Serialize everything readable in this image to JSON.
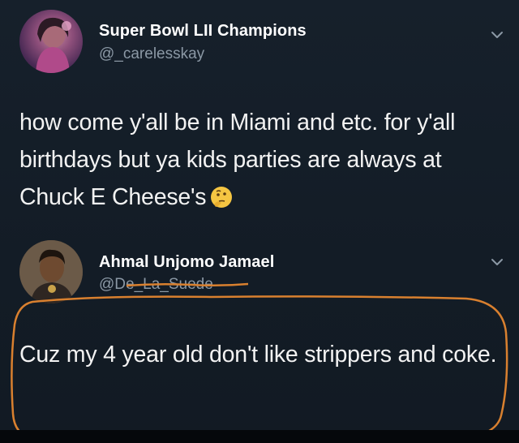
{
  "tweets": [
    {
      "display_name": "Super Bowl LII Champions",
      "handle": "@_carelesskay",
      "text": "how come y'all be in Miami and etc. for y'all birthdays but ya kids parties are always at Chuck E Cheese's",
      "avatar": "user-avatar-photo",
      "emoji": "thinking-face-emoji"
    },
    {
      "display_name": "Ahmal Unjomo Jamael",
      "handle": "@De_La_Suede",
      "text": "Cuz my 4 year old don't like strippers and coke.",
      "avatar": "user-avatar-photo"
    }
  ],
  "icons": {
    "menu": "chevron-down-icon"
  },
  "colors": {
    "background": "#141d27",
    "text": "#f2f2f2",
    "handle": "#8b98a5",
    "annotation": "#d9802f"
  }
}
